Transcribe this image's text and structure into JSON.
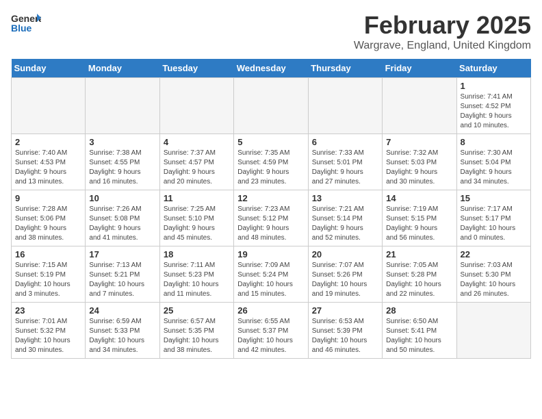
{
  "header": {
    "logo_general": "General",
    "logo_blue": "Blue",
    "month_year": "February 2025",
    "location": "Wargrave, England, United Kingdom"
  },
  "days_of_week": [
    "Sunday",
    "Monday",
    "Tuesday",
    "Wednesday",
    "Thursday",
    "Friday",
    "Saturday"
  ],
  "weeks": [
    [
      {
        "day": "",
        "details": ""
      },
      {
        "day": "",
        "details": ""
      },
      {
        "day": "",
        "details": ""
      },
      {
        "day": "",
        "details": ""
      },
      {
        "day": "",
        "details": ""
      },
      {
        "day": "",
        "details": ""
      },
      {
        "day": "1",
        "details": "Sunrise: 7:41 AM\nSunset: 4:52 PM\nDaylight: 9 hours\nand 10 minutes."
      }
    ],
    [
      {
        "day": "2",
        "details": "Sunrise: 7:40 AM\nSunset: 4:53 PM\nDaylight: 9 hours\nand 13 minutes."
      },
      {
        "day": "3",
        "details": "Sunrise: 7:38 AM\nSunset: 4:55 PM\nDaylight: 9 hours\nand 16 minutes."
      },
      {
        "day": "4",
        "details": "Sunrise: 7:37 AM\nSunset: 4:57 PM\nDaylight: 9 hours\nand 20 minutes."
      },
      {
        "day": "5",
        "details": "Sunrise: 7:35 AM\nSunset: 4:59 PM\nDaylight: 9 hours\nand 23 minutes."
      },
      {
        "day": "6",
        "details": "Sunrise: 7:33 AM\nSunset: 5:01 PM\nDaylight: 9 hours\nand 27 minutes."
      },
      {
        "day": "7",
        "details": "Sunrise: 7:32 AM\nSunset: 5:03 PM\nDaylight: 9 hours\nand 30 minutes."
      },
      {
        "day": "8",
        "details": "Sunrise: 7:30 AM\nSunset: 5:04 PM\nDaylight: 9 hours\nand 34 minutes."
      }
    ],
    [
      {
        "day": "9",
        "details": "Sunrise: 7:28 AM\nSunset: 5:06 PM\nDaylight: 9 hours\nand 38 minutes."
      },
      {
        "day": "10",
        "details": "Sunrise: 7:26 AM\nSunset: 5:08 PM\nDaylight: 9 hours\nand 41 minutes."
      },
      {
        "day": "11",
        "details": "Sunrise: 7:25 AM\nSunset: 5:10 PM\nDaylight: 9 hours\nand 45 minutes."
      },
      {
        "day": "12",
        "details": "Sunrise: 7:23 AM\nSunset: 5:12 PM\nDaylight: 9 hours\nand 48 minutes."
      },
      {
        "day": "13",
        "details": "Sunrise: 7:21 AM\nSunset: 5:14 PM\nDaylight: 9 hours\nand 52 minutes."
      },
      {
        "day": "14",
        "details": "Sunrise: 7:19 AM\nSunset: 5:15 PM\nDaylight: 9 hours\nand 56 minutes."
      },
      {
        "day": "15",
        "details": "Sunrise: 7:17 AM\nSunset: 5:17 PM\nDaylight: 10 hours\nand 0 minutes."
      }
    ],
    [
      {
        "day": "16",
        "details": "Sunrise: 7:15 AM\nSunset: 5:19 PM\nDaylight: 10 hours\nand 3 minutes."
      },
      {
        "day": "17",
        "details": "Sunrise: 7:13 AM\nSunset: 5:21 PM\nDaylight: 10 hours\nand 7 minutes."
      },
      {
        "day": "18",
        "details": "Sunrise: 7:11 AM\nSunset: 5:23 PM\nDaylight: 10 hours\nand 11 minutes."
      },
      {
        "day": "19",
        "details": "Sunrise: 7:09 AM\nSunset: 5:24 PM\nDaylight: 10 hours\nand 15 minutes."
      },
      {
        "day": "20",
        "details": "Sunrise: 7:07 AM\nSunset: 5:26 PM\nDaylight: 10 hours\nand 19 minutes."
      },
      {
        "day": "21",
        "details": "Sunrise: 7:05 AM\nSunset: 5:28 PM\nDaylight: 10 hours\nand 22 minutes."
      },
      {
        "day": "22",
        "details": "Sunrise: 7:03 AM\nSunset: 5:30 PM\nDaylight: 10 hours\nand 26 minutes."
      }
    ],
    [
      {
        "day": "23",
        "details": "Sunrise: 7:01 AM\nSunset: 5:32 PM\nDaylight: 10 hours\nand 30 minutes."
      },
      {
        "day": "24",
        "details": "Sunrise: 6:59 AM\nSunset: 5:33 PM\nDaylight: 10 hours\nand 34 minutes."
      },
      {
        "day": "25",
        "details": "Sunrise: 6:57 AM\nSunset: 5:35 PM\nDaylight: 10 hours\nand 38 minutes."
      },
      {
        "day": "26",
        "details": "Sunrise: 6:55 AM\nSunset: 5:37 PM\nDaylight: 10 hours\nand 42 minutes."
      },
      {
        "day": "27",
        "details": "Sunrise: 6:53 AM\nSunset: 5:39 PM\nDaylight: 10 hours\nand 46 minutes."
      },
      {
        "day": "28",
        "details": "Sunrise: 6:50 AM\nSunset: 5:41 PM\nDaylight: 10 hours\nand 50 minutes."
      },
      {
        "day": "",
        "details": ""
      }
    ]
  ]
}
